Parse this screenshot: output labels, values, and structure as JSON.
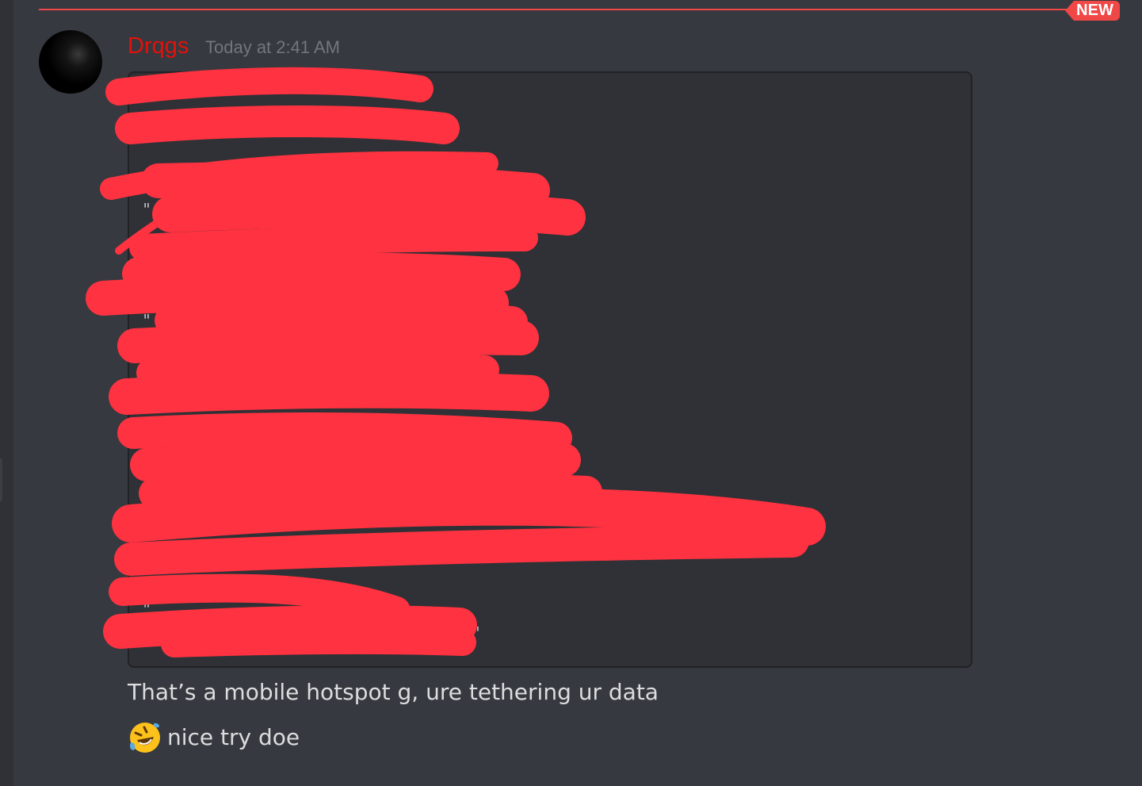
{
  "divider": {
    "badge": "NEW"
  },
  "message": {
    "author": "Drqgs",
    "timestamp": "Today at 2:41 AM",
    "lines": [
      "That’s a mobile hotspot g, ure tethering ur data",
      "nice try doe"
    ],
    "emoji_icon": "rolling-on-the-floor-laughing-emoji",
    "code_fragments": [
      "\"",
      "\"",
      "\"",
      "\"",
      "\"",
      "\""
    ]
  },
  "colors": {
    "background": "#36393f",
    "author": "#e3110b",
    "new_badge": "#f04747",
    "redaction": "#fe3240",
    "code_block": "#2f3136"
  }
}
